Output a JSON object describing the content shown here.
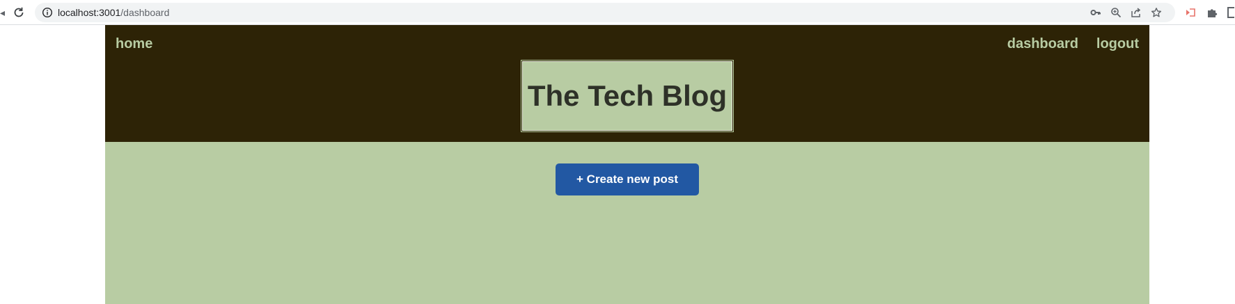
{
  "browser": {
    "url_host": "localhost:3001",
    "url_path": "/dashboard",
    "icons": [
      "reload-icon",
      "info-icon",
      "key-icon",
      "zoom-icon",
      "share-icon",
      "star-icon",
      "extension-icon",
      "puzzle-icon"
    ]
  },
  "header": {
    "nav": {
      "home": "home",
      "dashboard": "dashboard",
      "logout": "logout"
    },
    "title": "The Tech Blog"
  },
  "main": {
    "create_button_label": "+ Create new post"
  },
  "colors": {
    "header_bg": "#2d2306",
    "nav_link": "#b8cca3",
    "content_bg": "#b8cca3",
    "title_text": "#2e3128",
    "button_bg": "#2258a3",
    "button_text": "#ffffff"
  }
}
